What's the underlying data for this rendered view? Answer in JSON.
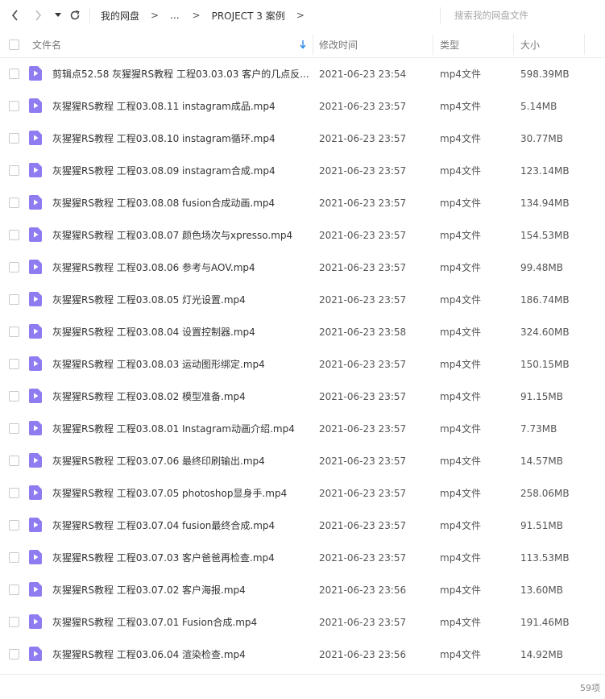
{
  "toolbar": {
    "breadcrumb": [
      "我的网盘",
      "...",
      "PROJECT 3 案例"
    ],
    "breadcrumb_sep": ">",
    "search_placeholder": "搜索我的网盘文件"
  },
  "columns": {
    "name": "文件名",
    "modified": "修改时间",
    "type": "类型",
    "size": "大小"
  },
  "icon_color": "#8e7cf0",
  "files": [
    {
      "name": "剪辑点52.58  灰猩猩RS教程 工程03.03.03 客户的几点反...",
      "modified": "2021-06-23 23:54",
      "type": "mp4文件",
      "size": "598.39MB"
    },
    {
      "name": "灰猩猩RS教程 工程03.08.11 instagram成品.mp4",
      "modified": "2021-06-23 23:57",
      "type": "mp4文件",
      "size": "5.14MB"
    },
    {
      "name": "灰猩猩RS教程 工程03.08.10 instagram循环.mp4",
      "modified": "2021-06-23 23:57",
      "type": "mp4文件",
      "size": "30.77MB"
    },
    {
      "name": "灰猩猩RS教程 工程03.08.09 instagram合成.mp4",
      "modified": "2021-06-23 23:57",
      "type": "mp4文件",
      "size": "123.14MB"
    },
    {
      "name": "灰猩猩RS教程 工程03.08.08 fusion合成动画.mp4",
      "modified": "2021-06-23 23:57",
      "type": "mp4文件",
      "size": "134.94MB"
    },
    {
      "name": "灰猩猩RS教程 工程03.08.07 颜色场次与xpresso.mp4",
      "modified": "2021-06-23 23:57",
      "type": "mp4文件",
      "size": "154.53MB"
    },
    {
      "name": "灰猩猩RS教程 工程03.08.06 参考与AOV.mp4",
      "modified": "2021-06-23 23:57",
      "type": "mp4文件",
      "size": "99.48MB"
    },
    {
      "name": "灰猩猩RS教程 工程03.08.05 灯光设置.mp4",
      "modified": "2021-06-23 23:57",
      "type": "mp4文件",
      "size": "186.74MB"
    },
    {
      "name": "灰猩猩RS教程 工程03.08.04 设置控制器.mp4",
      "modified": "2021-06-23 23:58",
      "type": "mp4文件",
      "size": "324.60MB"
    },
    {
      "name": "灰猩猩RS教程 工程03.08.03 运动图形绑定.mp4",
      "modified": "2021-06-23 23:57",
      "type": "mp4文件",
      "size": "150.15MB"
    },
    {
      "name": "灰猩猩RS教程 工程03.08.02 模型准备.mp4",
      "modified": "2021-06-23 23:57",
      "type": "mp4文件",
      "size": "91.15MB"
    },
    {
      "name": "灰猩猩RS教程 工程03.08.01 Instagram动画介绍.mp4",
      "modified": "2021-06-23 23:57",
      "type": "mp4文件",
      "size": "7.73MB"
    },
    {
      "name": "灰猩猩RS教程 工程03.07.06 最终印刷输出.mp4",
      "modified": "2021-06-23 23:57",
      "type": "mp4文件",
      "size": "14.57MB"
    },
    {
      "name": "灰猩猩RS教程 工程03.07.05 photoshop显身手.mp4",
      "modified": "2021-06-23 23:57",
      "type": "mp4文件",
      "size": "258.06MB"
    },
    {
      "name": "灰猩猩RS教程 工程03.07.04 fusion最终合成.mp4",
      "modified": "2021-06-23 23:57",
      "type": "mp4文件",
      "size": "91.51MB"
    },
    {
      "name": "灰猩猩RS教程 工程03.07.03 客户爸爸再检查.mp4",
      "modified": "2021-06-23 23:57",
      "type": "mp4文件",
      "size": "113.53MB"
    },
    {
      "name": "灰猩猩RS教程 工程03.07.02 客户海报.mp4",
      "modified": "2021-06-23 23:56",
      "type": "mp4文件",
      "size": "13.60MB"
    },
    {
      "name": "灰猩猩RS教程 工程03.07.01 Fusion合成.mp4",
      "modified": "2021-06-23 23:57",
      "type": "mp4文件",
      "size": "191.46MB"
    },
    {
      "name": "灰猩猩RS教程 工程03.06.04 渲染检查.mp4",
      "modified": "2021-06-23 23:56",
      "type": "mp4文件",
      "size": "14.92MB"
    }
  ],
  "footer": {
    "item_count": "59项"
  }
}
